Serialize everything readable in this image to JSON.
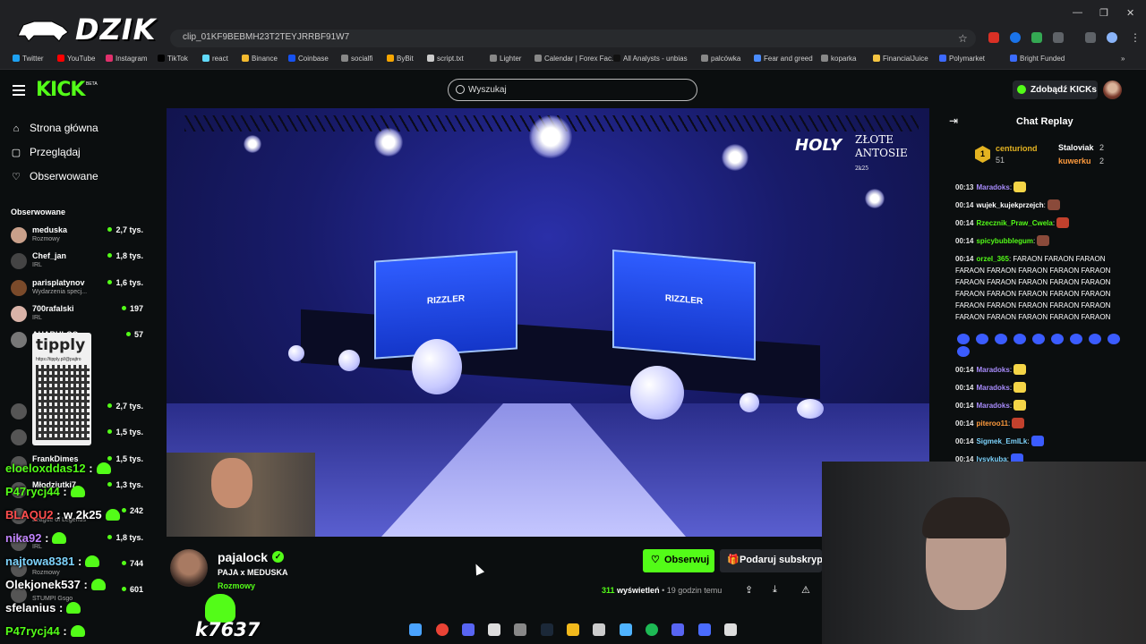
{
  "browser": {
    "url": "clip_01KF9BEBMH23T2TEYJRRBF91W7",
    "bookmarks": [
      "Twitter",
      "YouTube",
      "Instagram",
      "TikTok",
      "react",
      "Binance",
      "Coinbase",
      "socialfi",
      "ByBit",
      "script.txt",
      "Lighter",
      "Calendar | Forex Fac...",
      "All Analysts - unbias",
      "palcówka",
      "Fear and greed",
      "koparka",
      "FinancialJuice",
      "Polymarket",
      "Bright Funded"
    ],
    "bookmarks_more": "»",
    "win_minimize": "—",
    "win_restore": "❐",
    "win_close": "✕"
  },
  "overlay": {
    "logo_text": "DZIK",
    "tipply_logo": "tipply",
    "tipply_url": "https://tipply.pl/@pajtro",
    "counter": "k7637",
    "chat": [
      {
        "user": "eloeloxddas12",
        "text": ":",
        "color": "#53fc18"
      },
      {
        "user": "P47rycj44",
        "text": ":",
        "color": "#53fc18"
      },
      {
        "user": "BLAQU2",
        "text": ": w 2k25",
        "color": "#ff4d4d"
      },
      {
        "user": "nika92",
        "text": ":",
        "color": "#c084fc"
      },
      {
        "user": "najtowa8381",
        "text": ":",
        "color": "#7dd3fc"
      },
      {
        "user": "Olekjonek537",
        "text": ":",
        "color": "#ffffff"
      },
      {
        "user": "sfelanius",
        "text": ":",
        "color": "#ffffff"
      },
      {
        "user": "P47rycj44",
        "text": ":",
        "color": "#53fc18"
      }
    ]
  },
  "header": {
    "logo": "KICK",
    "beta": "BETA",
    "search_placeholder": "Wyszukaj",
    "kicks_button": "Zdobądź KICKs"
  },
  "sidebar": {
    "nav": [
      {
        "label": "Strona główna",
        "icon": "⌂"
      },
      {
        "label": "Przeglądaj",
        "icon": "▢"
      },
      {
        "label": "Obserwowane",
        "icon": "♡"
      }
    ],
    "followed_title": "Obserwowane",
    "channels": [
      {
        "name": "meduska",
        "category": "Rozmowy",
        "viewers": "2,7 tys.",
        "color": "#c9a08a"
      },
      {
        "name": "Chef_jan",
        "category": "IRL",
        "viewers": "1,8 tys.",
        "color": "#444"
      },
      {
        "name": "parisplatynov",
        "category": "Wydarzenia specj...",
        "viewers": "1,6 tys.",
        "color": "#7a4a2a"
      },
      {
        "name": "700rafalski",
        "category": "IRL",
        "viewers": "197",
        "color": "#d9b3a8"
      },
      {
        "name": "AHABULCO",
        "category": "",
        "viewers": "57",
        "color": "#777"
      },
      {
        "name": "",
        "category": "",
        "viewers": "2,7 tys.",
        "color": "#555"
      },
      {
        "name": "",
        "category": "Wydarzenia specj...",
        "viewers": "1,5 tys.",
        "color": "#555"
      },
      {
        "name": "FrankDimes",
        "category": "",
        "viewers": "1,5 tys.",
        "color": "#555"
      },
      {
        "name": "Młodziutki7",
        "category": "",
        "viewers": "1,3 tys.",
        "color": "#555"
      },
      {
        "name": "",
        "category": "League of Legends",
        "viewers": "242",
        "color": "#555"
      },
      {
        "name": "",
        "category": "IRL",
        "viewers": "1,8 tys.",
        "color": "#555"
      },
      {
        "name": "",
        "category": "Rozmowy",
        "viewers": "744",
        "color": "#555"
      },
      {
        "name": "",
        "category": "STUMPI Gsgo",
        "viewers": "601",
        "color": "#555"
      }
    ]
  },
  "video": {
    "screen_left": "RIZZLER",
    "screen_right": "RIZZLER",
    "watermark_holy": "HOLY",
    "watermark_zlote": "ZŁOTE ANTOSIE",
    "watermark_year": "2k25"
  },
  "stream": {
    "streamer": "pajalock",
    "title": "PAJA x MEDUSKA",
    "category": "Rozmowy",
    "follow": "Obserwuj",
    "gift": "Podaruj subskrypcje",
    "views_count": "311",
    "views_label": "wyświetleń",
    "time_ago": "• 19 godzin temu",
    "share_icon": "⇪",
    "download_icon": "⤓",
    "report_icon": "⚠"
  },
  "chat": {
    "title": "Chat Replay",
    "collapse_icon": "⇥",
    "top_gifters": [
      {
        "rank": "1",
        "name": "centuriond",
        "count": "51",
        "color": "#e4b321"
      },
      {
        "name": "Staloviak",
        "count": "2",
        "color": "#ffffff"
      },
      {
        "name": "kuwerku",
        "count": "2",
        "color": "#ff9b3d"
      }
    ],
    "messages": [
      {
        "ts": "00:13",
        "user": "Maradoks",
        "text": ":",
        "color": "#a78bfa",
        "emotes": 1
      },
      {
        "ts": "00:14",
        "user": "wujek_kujekprzejch",
        "text": ":",
        "color": "#ffffff",
        "emotes": 1
      },
      {
        "ts": "00:14",
        "user": "Rzecznik_Praw_Cwela",
        "text": ":",
        "color": "#53fc18",
        "emotes": 1
      },
      {
        "ts": "00:14",
        "user": "spicybubblegum",
        "text": ":",
        "color": "#53fc18",
        "emotes": 1
      },
      {
        "ts": "00:14",
        "user": "orzel_365",
        "text": ": FARAON FARAON FARAON FARAON FARAON FARAON FARAON FARAON FARAON FARAON FARAON FARAON FARAON FARAON FARAON FARAON FARAON FARAON FARAON FARAON FARAON FARAON FARAON FARAON FARAON FARAON FARAON FARAON",
        "color": "#53fc18",
        "emotes": 0
      },
      {
        "ts": "00:14",
        "user": "Maradoks",
        "text": ":",
        "color": "#a78bfa",
        "emotes": 1
      },
      {
        "ts": "00:14",
        "user": "Maradoks",
        "text": ":",
        "color": "#a78bfa",
        "emotes": 1
      },
      {
        "ts": "00:14",
        "user": "Maradoks",
        "text": ":",
        "color": "#a78bfa",
        "emotes": 1
      },
      {
        "ts": "00:14",
        "user": "piteroo11",
        "text": ":",
        "color": "#ff9b3d",
        "emotes": 1
      },
      {
        "ts": "00:14",
        "user": "Sigmek_EmlLk",
        "text": ":",
        "color": "#7dd3fc",
        "emotes": 1
      },
      {
        "ts": "00:14",
        "user": "lysvkuba",
        "text": ":",
        "color": "#7dd3fc",
        "emotes": 1
      }
    ]
  }
}
